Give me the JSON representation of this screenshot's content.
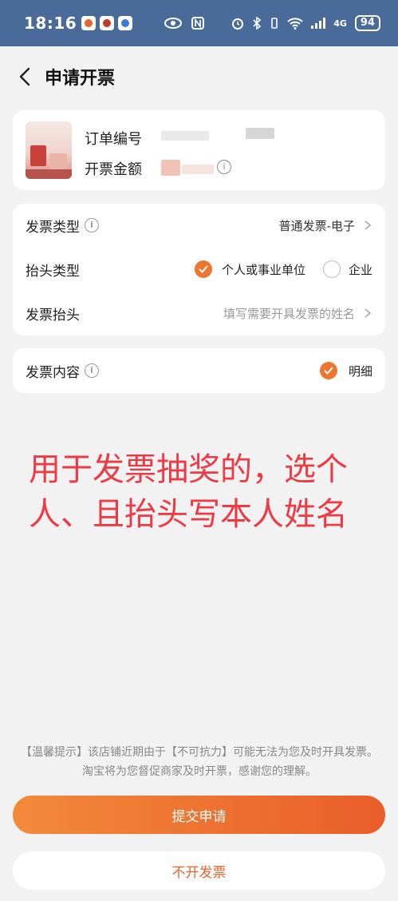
{
  "status_bar": {
    "time": "18:16",
    "network": "4G",
    "battery": "94"
  },
  "header": {
    "title": "申请开票"
  },
  "order": {
    "order_number_label": "订单编号",
    "invoice_amount_label": "开票金额"
  },
  "invoice": {
    "type_label": "发票类型",
    "type_value": "普通发票-电子",
    "title_type_label": "抬头类型",
    "title_type_options": [
      {
        "label": "个人或事业单位",
        "checked": true
      },
      {
        "label": "企业",
        "checked": false
      }
    ],
    "title_label": "发票抬头",
    "title_placeholder": "填写需要开具发票的姓名",
    "content_label": "发票内容",
    "content_option": "明细"
  },
  "annotation": {
    "text": "用于发票抽奖的，选个人、且抬头写本人姓名"
  },
  "notice": {
    "text": "【温馨提示】该店铺近期由于【不可抗力】可能无法为您及时开具发票。淘宝将为您督促商家及时开票，感谢您的理解。"
  },
  "actions": {
    "submit_label": "提交申请",
    "no_invoice_label": "不开发票"
  },
  "colors": {
    "accent": "#ee7530",
    "annotation": "#ec3b45",
    "status_bar": "#4a6b9a"
  },
  "icons": [
    "back-arrow-icon",
    "info-icon",
    "chevron-right-icon",
    "check-icon",
    "wifi-icon",
    "signal-icon",
    "bluetooth-icon",
    "alarm-icon",
    "nfc-icon",
    "eye-icon"
  ]
}
